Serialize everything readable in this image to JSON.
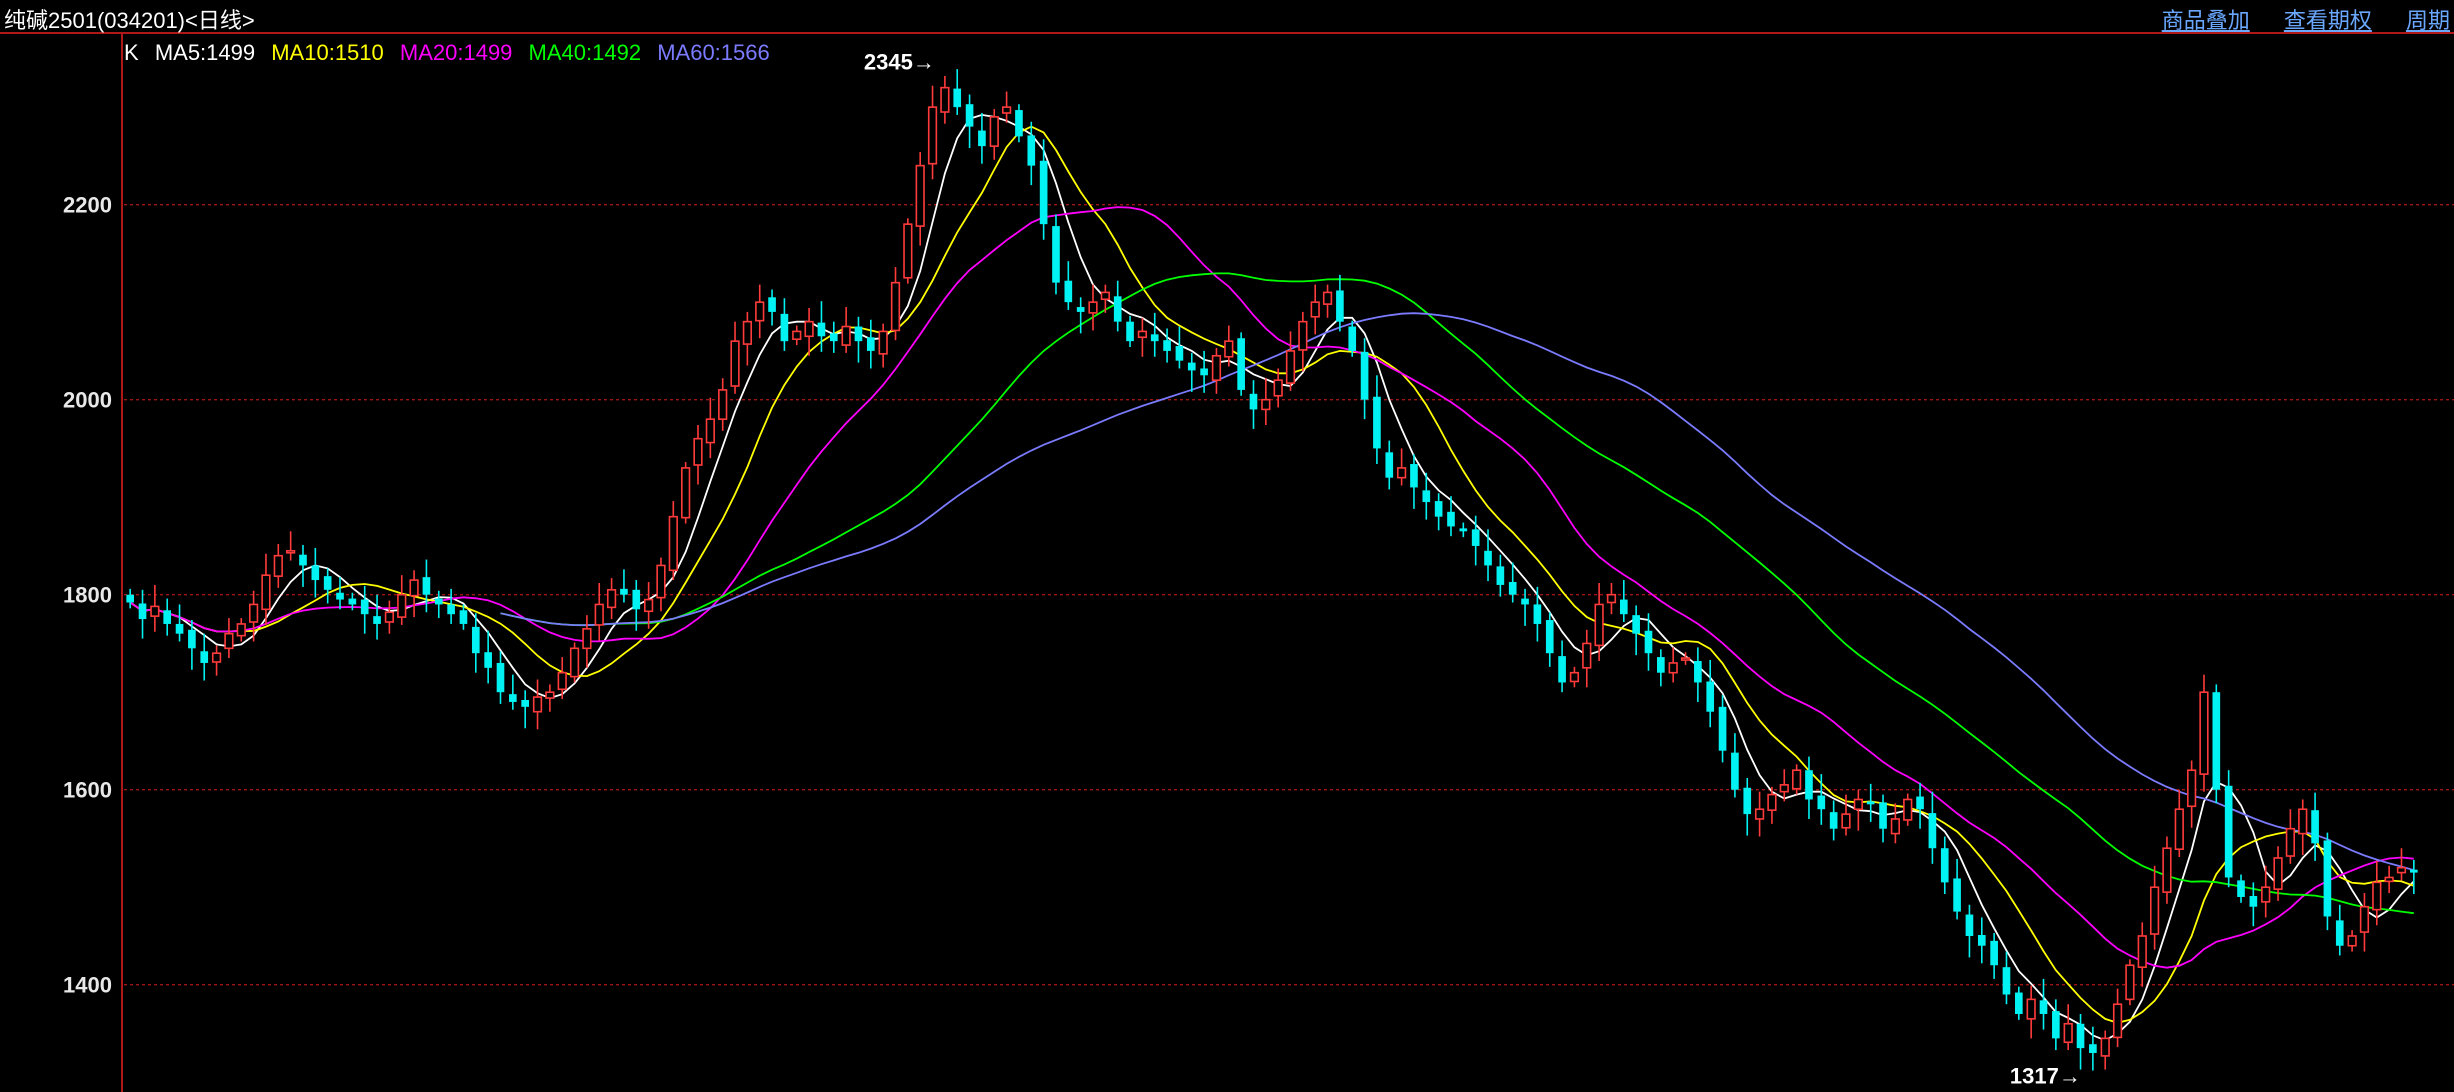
{
  "header": {
    "title": "纯碱2501(034201)<日线>",
    "links": [
      "商品叠加",
      "查看期权",
      "周期"
    ]
  },
  "legend": {
    "prefix": "K",
    "items": [
      {
        "label": "MA5:1499",
        "color": "#ffffff"
      },
      {
        "label": "MA10:1510",
        "color": "#ffff00"
      },
      {
        "label": "MA20:1499",
        "color": "#ff00ff"
      },
      {
        "label": "MA40:1492",
        "color": "#00ff00"
      },
      {
        "label": "MA60:1566",
        "color": "#7b7bff"
      }
    ]
  },
  "colors": {
    "up": "#ff3b3b",
    "down": "#00f2f2",
    "grid": "#a01414",
    "axis": "#b01818"
  },
  "chart_data": {
    "type": "candlestick",
    "ylim": [
      1290,
      2375
    ],
    "yticks": [
      1400,
      1600,
      1800,
      2000,
      2200
    ],
    "annotations": {
      "max": {
        "value": 2345,
        "label": "2345→"
      },
      "min": {
        "value": 1317,
        "label": "1317→"
      }
    },
    "series_close": [
      1792,
      1775,
      1788,
      1770,
      1760,
      1745,
      1730,
      1740,
      1760,
      1770,
      1790,
      1820,
      1840,
      1845,
      1830,
      1815,
      1805,
      1795,
      1790,
      1780,
      1770,
      1782,
      1800,
      1815,
      1800,
      1790,
      1780,
      1770,
      1740,
      1725,
      1700,
      1690,
      1685,
      1695,
      1700,
      1720,
      1745,
      1765,
      1790,
      1805,
      1800,
      1785,
      1795,
      1830,
      1880,
      1930,
      1960,
      1980,
      2010,
      2060,
      2080,
      2100,
      2090,
      2060,
      2070,
      2080,
      2065,
      2060,
      2075,
      2060,
      2050,
      2070,
      2120,
      2180,
      2240,
      2300,
      2320,
      2300,
      2280,
      2260,
      2290,
      2300,
      2270,
      2240,
      2180,
      2120,
      2100,
      2090,
      2100,
      2110,
      2080,
      2060,
      2070,
      2060,
      2050,
      2040,
      2030,
      2025,
      2045,
      2060,
      2010,
      1990,
      2000,
      2020,
      2050,
      2080,
      2100,
      2110,
      2080,
      2050,
      2000,
      1950,
      1920,
      1930,
      1910,
      1895,
      1880,
      1870,
      1865,
      1850,
      1830,
      1810,
      1800,
      1790,
      1770,
      1740,
      1710,
      1720,
      1750,
      1790,
      1800,
      1780,
      1760,
      1740,
      1720,
      1730,
      1735,
      1710,
      1680,
      1640,
      1600,
      1575,
      1580,
      1595,
      1605,
      1620,
      1590,
      1580,
      1560,
      1575,
      1590,
      1585,
      1560,
      1570,
      1590,
      1580,
      1540,
      1505,
      1475,
      1450,
      1440,
      1420,
      1390,
      1370,
      1385,
      1370,
      1345,
      1360,
      1335,
      1330,
      1345,
      1380,
      1420,
      1450,
      1500,
      1540,
      1580,
      1620,
      1700,
      1600,
      1510,
      1490,
      1480,
      1500,
      1530,
      1560,
      1580,
      1545,
      1470,
      1440,
      1450,
      1480,
      1505,
      1510,
      1520,
      1515
    ]
  }
}
